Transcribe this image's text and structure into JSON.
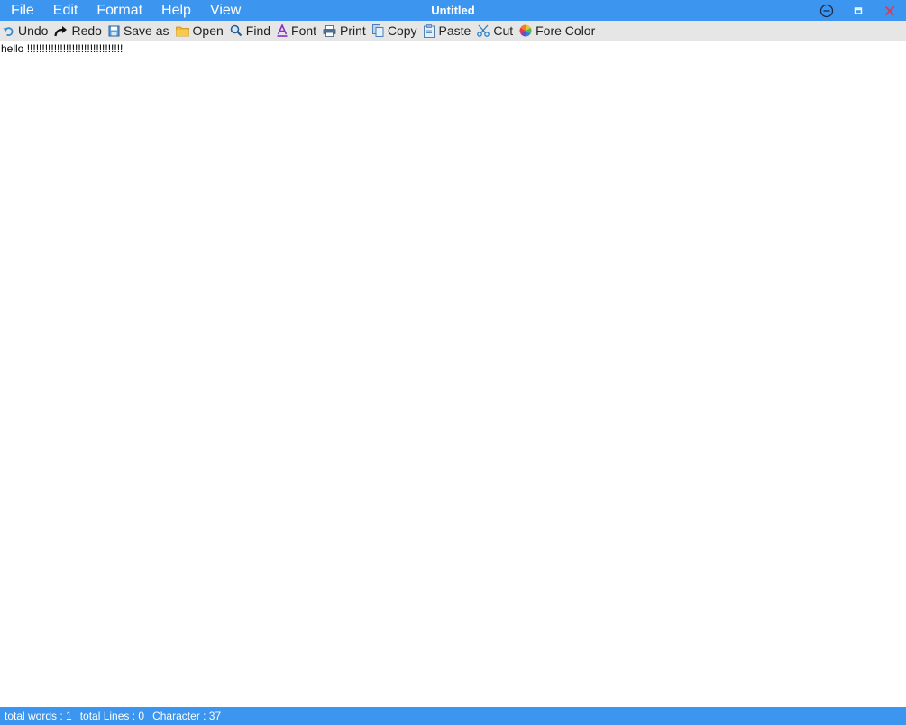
{
  "window": {
    "title": "Untitled",
    "accent_color": "#3c95ee",
    "controls": [
      "minimize-circle-icon",
      "maximize-icon",
      "close-icon"
    ]
  },
  "menu": {
    "items": [
      {
        "label": "File"
      },
      {
        "label": "Edit"
      },
      {
        "label": "Format"
      },
      {
        "label": "Help"
      },
      {
        "label": "View"
      }
    ]
  },
  "toolbar": {
    "buttons": [
      {
        "label": "Undo",
        "icon": "undo-icon"
      },
      {
        "label": "Redo",
        "icon": "redo-icon"
      },
      {
        "label": "Save as",
        "icon": "save-icon"
      },
      {
        "label": "Open",
        "icon": "folder-icon"
      },
      {
        "label": "Find",
        "icon": "search-icon"
      },
      {
        "label": "Font",
        "icon": "font-icon"
      },
      {
        "label": "Print",
        "icon": "printer-icon"
      },
      {
        "label": "Copy",
        "icon": "copy-icon"
      },
      {
        "label": "Paste",
        "icon": "paste-icon"
      },
      {
        "label": "Cut",
        "icon": "scissors-icon"
      },
      {
        "label": "Fore Color",
        "icon": "color-wheel-icon"
      }
    ]
  },
  "editor": {
    "content": "hello !!!!!!!!!!!!!!!!!!!!!!!!!!!!!!!!"
  },
  "status": {
    "words": "total words : 1",
    "lines": "total Lines : 0",
    "characters": "Character : 37"
  }
}
